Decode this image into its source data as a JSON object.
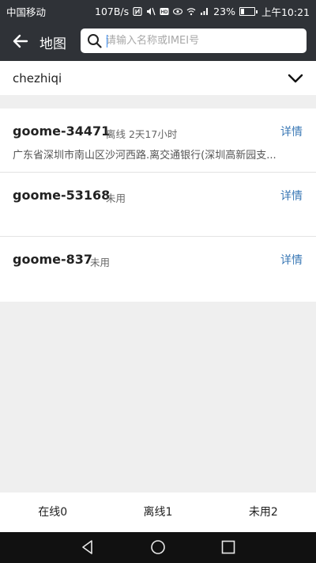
{
  "status_bar": {
    "carrier": "中国移动",
    "net_speed": "107B/s",
    "battery": "23%",
    "time": "上午10:21"
  },
  "header": {
    "back_icon": "back-arrow-icon",
    "title": "地图",
    "search_icon": "search-icon",
    "search_placeholder": "请输入名称或IMEI号"
  },
  "group": {
    "label": "chezhiqi",
    "icon": "chevron-down-icon"
  },
  "devices": [
    {
      "name": "goome-34471",
      "status": "离线  2天17小时",
      "detail": "详情",
      "address": "广东省深圳市南山区沙河西路.离交通银行(深圳高新园支..."
    },
    {
      "name": "goome-53168",
      "status": "未用",
      "detail": "详情",
      "address": ""
    },
    {
      "name": "goome-837",
      "status": "未用",
      "detail": "详情",
      "address": ""
    }
  ],
  "tabs": [
    {
      "label": "在线0"
    },
    {
      "label": "离线1"
    },
    {
      "label": "未用2"
    }
  ],
  "colors": {
    "header_bg": "#2f3237",
    "link": "#3a78b5",
    "page_bg": "#efefef"
  }
}
